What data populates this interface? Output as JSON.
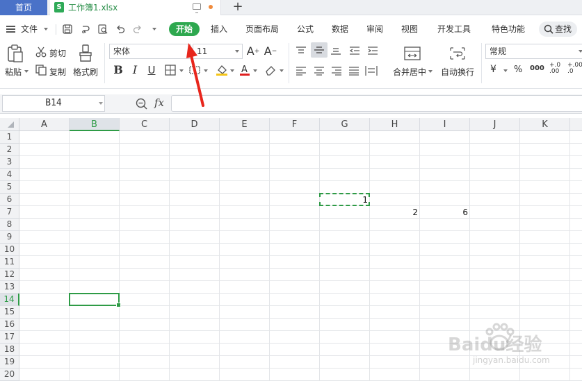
{
  "tabs": {
    "home": "首页",
    "file": "工作簿1.xlsx",
    "new_tab": "+"
  },
  "menubar": {
    "file_menu": "文件",
    "items": [
      "开始",
      "插入",
      "页面布局",
      "公式",
      "数据",
      "审阅",
      "视图",
      "开发工具",
      "特色功能"
    ],
    "search": "查找"
  },
  "ribbon": {
    "paste": "粘贴",
    "cut": "剪切",
    "copy": "复制",
    "format_painter": "格式刷",
    "font_name": "宋体",
    "font_size": "11",
    "merge_center": "合并居中",
    "wrap_text": "自动换行",
    "number_format": "常规",
    "currency": "¥",
    "percent": "%",
    "thousands": "000",
    "inc_decimal": "+.0 .00",
    "dec_decimal": "+.00 .0"
  },
  "formula_bar": {
    "name_box": "B14",
    "fx": "fx",
    "value": ""
  },
  "grid": {
    "columns": [
      "A",
      "B",
      "C",
      "D",
      "E",
      "F",
      "G",
      "H",
      "I",
      "J",
      "K"
    ],
    "rows": [
      "1",
      "2",
      "3",
      "4",
      "5",
      "6",
      "7",
      "8",
      "9",
      "10",
      "11",
      "12",
      "13",
      "14",
      "15",
      "16",
      "17",
      "18",
      "19",
      "20"
    ],
    "selected_column": "B",
    "selected_row": "14",
    "cells": {
      "G6": "1",
      "H7": "2",
      "I7": "6"
    }
  },
  "colors": {
    "accent_green": "#2ea84f",
    "home_tab_blue": "#4a72c8",
    "arrow_red": "#e8261c"
  },
  "watermark": {
    "brand": "Baidu经验",
    "url": "jingyan.baidu.com"
  }
}
